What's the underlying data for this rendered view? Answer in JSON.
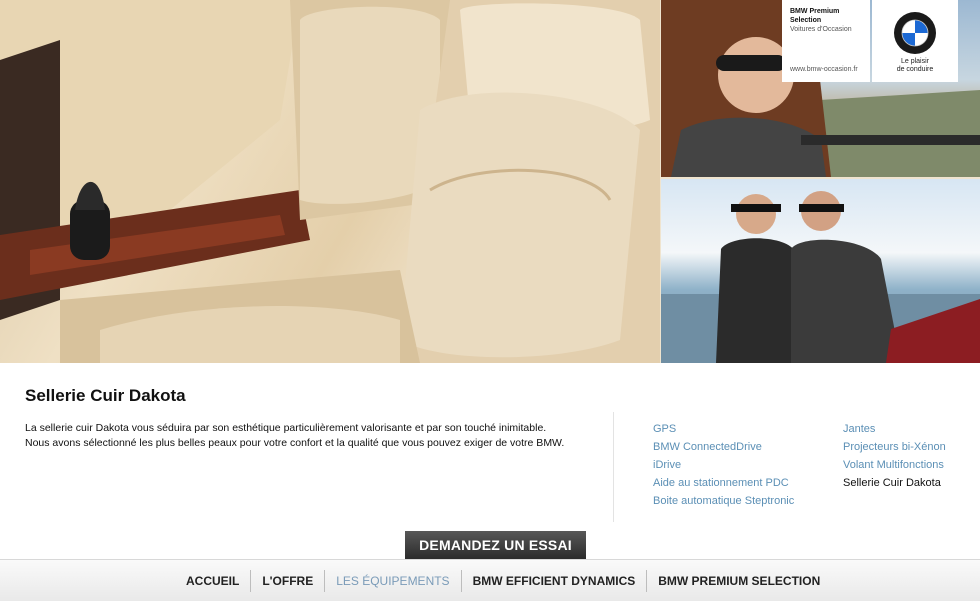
{
  "badge": {
    "title": "BMW Premium Selection",
    "subtitle": "Voitures d'Occasion",
    "url": "www.bmw-occasion.fr",
    "slogan_line1": "Le plaisir",
    "slogan_line2": "de conduire"
  },
  "content": {
    "title": "Sellerie Cuir Dakota",
    "paragraph_line1": "La sellerie cuir Dakota vous séduira par son esthétique particulièrement valorisante et par son touché inimitable.",
    "paragraph_line2": "Nous avons sélectionné les plus belles peaux pour votre confort et la qualité que vous pouvez exiger de votre BMW."
  },
  "features": {
    "col1": [
      "GPS",
      "BMW ConnectedDrive",
      "iDrive",
      "Aide au stationnement PDC",
      "Boite automatique Steptronic"
    ],
    "col2": [
      "Jantes",
      "Projecteurs bi-Xénon",
      "Volant Multifonctions",
      "Sellerie Cuir Dakota"
    ],
    "active": "Sellerie Cuir Dakota"
  },
  "cta": {
    "label": "DEMANDEZ UN ESSAI"
  },
  "nav": {
    "items": [
      "ACCUEIL",
      "L'OFFRE",
      "LES ÉQUIPEMENTS",
      "BMW EFFICIENT DYNAMICS",
      "BMW PREMIUM SELECTION"
    ],
    "active": "LES ÉQUIPEMENTS"
  },
  "colors": {
    "link": "#5b8fb5",
    "nav_active": "#7a9bb8",
    "bmw_blue": "#1c69d4"
  }
}
